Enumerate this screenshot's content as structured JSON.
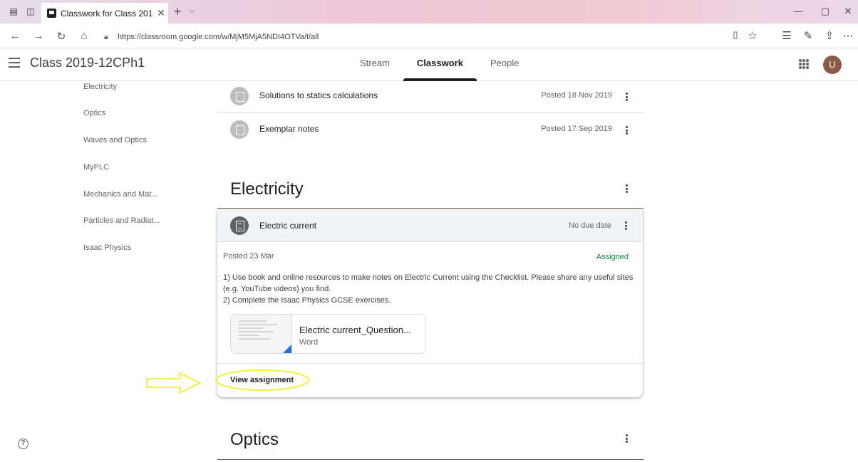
{
  "browser": {
    "tab_title": "Classwork for Class 201",
    "url": "https://classroom.google.com/w/MjM5MjA5NDI4OTVa/t/all"
  },
  "header": {
    "class_name": "Class 2019-12CPh1",
    "tabs": [
      {
        "label": "Stream",
        "active": false
      },
      {
        "label": "Classwork",
        "active": true
      },
      {
        "label": "People",
        "active": false
      }
    ],
    "avatar_letter": "U",
    "avatar_color": "#8d5a4a"
  },
  "sidebar": {
    "topics": [
      "Electricity",
      "Optics",
      "Waves and Optics",
      "MyPLC",
      "Mechanics and Mat...",
      "Particles and Radiat...",
      "Isaac Physics"
    ]
  },
  "materials": [
    {
      "title": "Solutions to statics calculations",
      "date": "Posted 18 Nov 2019"
    },
    {
      "title": "Exemplar notes",
      "date": "Posted 17 Sep 2019"
    }
  ],
  "sections": {
    "electricity": "Electricity",
    "optics": "Optics"
  },
  "assignment": {
    "title": "Electric current",
    "due": "No due date",
    "posted": "Posted 23 Mar",
    "status": "Assigned",
    "status_color": "#188038",
    "instructions_line1": "1) Use book and online resources to make notes on Electric Current using the Checklist. Please share any useful sites (e.g. YouTube videos) you find.",
    "instructions_line2": "2) Complete the Isaac Physics GCSE exercises.",
    "attachment_name": "Electric current_Question...",
    "attachment_type": "Word",
    "view_label": "View assignment"
  },
  "annotation_color": "#f4f03c",
  "help_glyph": "?"
}
